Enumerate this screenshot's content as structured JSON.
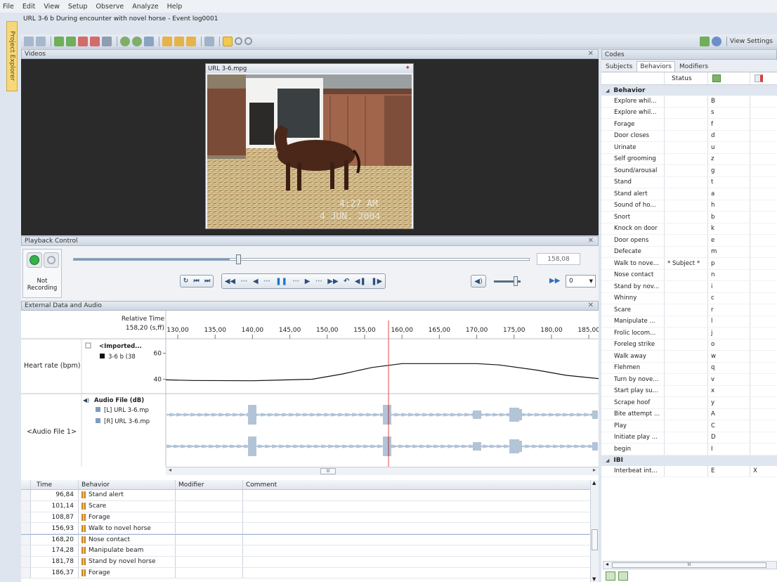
{
  "menu": [
    "File",
    "Edit",
    "View",
    "Setup",
    "Observe",
    "Analyze",
    "Help"
  ],
  "window_title": "URL 3-6 b During encounter with novel horse - Event log0001",
  "side_tab": "Project Explorer",
  "toolbar": {
    "view_settings": "View Settings"
  },
  "videos": {
    "title": "Videos",
    "video_title": "URL 3-6.mpg",
    "overlay_time": "4:27 AM",
    "overlay_date": "4 JUN. 2004"
  },
  "playback": {
    "title": "Playback Control",
    "recording_status": "Not\nRecording",
    "time_value": "158,08",
    "slider_position": 0.36,
    "speed_value": "0"
  },
  "external": {
    "title": "External Data and Audio",
    "relative_time_label": "Relative Time",
    "current_time": "158,20 (s,ff)",
    "ticks": [
      "130,00",
      "135,00",
      "140,00",
      "145,00",
      "150,00",
      "155,00",
      "160,00",
      "165,00",
      "170,00",
      "175,00",
      "180,00",
      "185,00"
    ],
    "tick_values": [
      130,
      135,
      140,
      145,
      150,
      155,
      160,
      165,
      170,
      175,
      180,
      185
    ],
    "x_range": [
      128.4,
      186.3
    ],
    "cursor_time": 158.2,
    "heart_rate": {
      "row_label": "Heart rate (bpm)",
      "group_label": "<Imported...",
      "series_label": "3-6 b  (38",
      "y_ticks": [
        "60",
        "40"
      ],
      "y_tick_values": [
        60,
        40
      ],
      "y_range": [
        30,
        70
      ],
      "points": [
        [
          128.4,
          39.5
        ],
        [
          132,
          39
        ],
        [
          140,
          38.8
        ],
        [
          148,
          40
        ],
        [
          152,
          44
        ],
        [
          156,
          49
        ],
        [
          160,
          52
        ],
        [
          165,
          52
        ],
        [
          170,
          52
        ],
        [
          173,
          51
        ],
        [
          178,
          47
        ],
        [
          182,
          43
        ],
        [
          186.3,
          40.5
        ]
      ]
    },
    "audio": {
      "row_label": "<Audio File 1>",
      "group_label": "Audio File (dB)",
      "left_label": "[L] URL 3-6.mp",
      "right_label": "[R] URL 3-6.mp"
    },
    "scroll_label": "III"
  },
  "event_table": {
    "headers": [
      "Time",
      "Behavior",
      "Modifier",
      "Comment"
    ],
    "rows": [
      {
        "time": "96,84",
        "behavior": "Stand alert"
      },
      {
        "time": "101,14",
        "behavior": "Scare"
      },
      {
        "time": "108,87",
        "behavior": "Forage"
      },
      {
        "time": "156,93",
        "behavior": "Walk to novel horse"
      },
      {
        "time": "168,20",
        "behavior": "Nose contact"
      },
      {
        "time": "174,28",
        "behavior": "Manipulate beam"
      },
      {
        "time": "181,78",
        "behavior": "Stand by novel horse"
      },
      {
        "time": "186,37",
        "behavior": "Forage"
      }
    ]
  },
  "codes": {
    "title": "Codes",
    "tabs": [
      "Subjects",
      "Behaviors",
      "Modifiers"
    ],
    "status_header": "Status",
    "groups": [
      {
        "name": "Behavior",
        "items": [
          {
            "name": "Explore whil...",
            "key": "B"
          },
          {
            "name": "Explore whil...",
            "key": "s"
          },
          {
            "name": "Forage",
            "key": "f"
          },
          {
            "name": "Door closes",
            "key": "d"
          },
          {
            "name": "Urinate",
            "key": "u"
          },
          {
            "name": "Self grooming",
            "key": "z"
          },
          {
            "name": "Sound/arousal",
            "key": "g"
          },
          {
            "name": "Stand",
            "key": "t"
          },
          {
            "name": "Stand alert",
            "key": "a"
          },
          {
            "name": "Sound of ho...",
            "key": "h"
          },
          {
            "name": "Snort",
            "key": "b"
          },
          {
            "name": "Knock on door",
            "key": "k"
          },
          {
            "name": "Door opens",
            "key": "e"
          },
          {
            "name": "Defecate",
            "key": "m"
          },
          {
            "name": "Walk to nove...",
            "status": "* Subject *",
            "key": "p"
          },
          {
            "name": "Nose contact",
            "key": "n"
          },
          {
            "name": "Stand by nov...",
            "key": "i"
          },
          {
            "name": "Whinny",
            "key": "c"
          },
          {
            "name": "Scare",
            "key": "r"
          },
          {
            "name": "Manipulate ...",
            "key": "l"
          },
          {
            "name": "Frolic locom...",
            "key": "j"
          },
          {
            "name": "Foreleg strike",
            "key": "o"
          },
          {
            "name": "Walk away",
            "key": "w"
          },
          {
            "name": "Flehmen",
            "key": "q"
          },
          {
            "name": "Turn by nove...",
            "key": "v"
          },
          {
            "name": "Start play su...",
            "key": "x"
          },
          {
            "name": "Scrape hoof",
            "key": "y"
          },
          {
            "name": "Bite attempt ...",
            "key": "A"
          },
          {
            "name": "Play",
            "key": "C"
          },
          {
            "name": "Initiate play ...",
            "key": "D"
          },
          {
            "name": "begin",
            "key": "I"
          }
        ]
      },
      {
        "name": "IBI",
        "items": [
          {
            "name": "Interbeat int...",
            "key": "E",
            "stop": "X"
          }
        ]
      }
    ],
    "scroll_label": "III"
  }
}
